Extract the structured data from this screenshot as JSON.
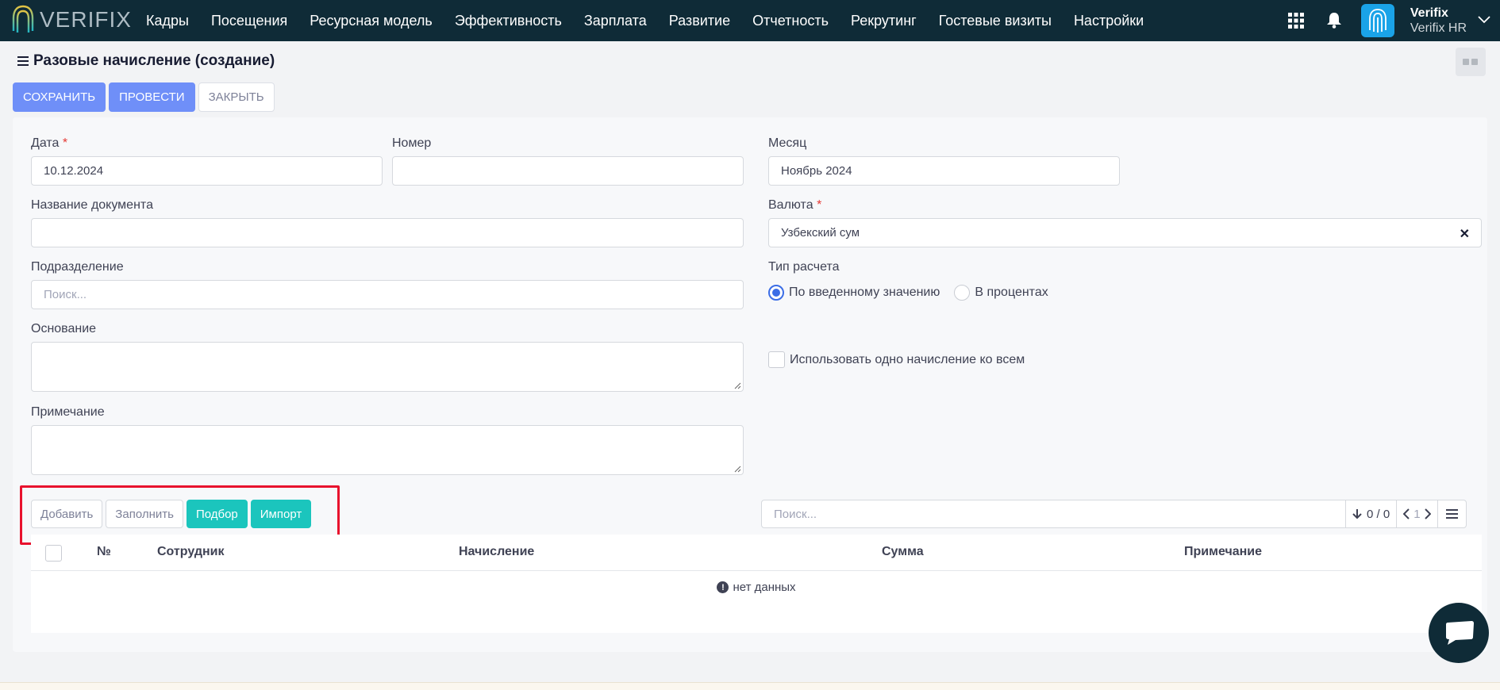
{
  "app": {
    "logo_text": "VERIFIX",
    "nav": [
      "Кадры",
      "Посещения",
      "Ресурсная модель",
      "Эффективность",
      "Зарплата",
      "Развитие",
      "Отчетность",
      "Рекрутинг",
      "Гостевые визиты",
      "Настройки"
    ],
    "user": {
      "name": "Verifix",
      "org": "Verifix HR"
    }
  },
  "page": {
    "title": "Разовые начисление (создание)",
    "actions": {
      "save": "Сохранить",
      "post": "Провести",
      "close": "Закрыть"
    }
  },
  "form": {
    "date": {
      "label": "Дата",
      "required": "*",
      "value": "10.12.2024"
    },
    "number": {
      "label": "Номер",
      "value": ""
    },
    "month": {
      "label": "Месяц",
      "value": "Ноябрь 2024"
    },
    "doc_name": {
      "label": "Название документа",
      "value": ""
    },
    "currency": {
      "label": "Валюта",
      "required": "*",
      "value": "Узбекский сум",
      "clear": "✕"
    },
    "division": {
      "label": "Подразделение",
      "placeholder": "Поиск..."
    },
    "calc_type": {
      "label": "Тип расчета",
      "options": [
        "По введенному значению",
        "В процентах"
      ],
      "selected": "По введенному значению"
    },
    "basis": {
      "label": "Основание"
    },
    "one_accrual": {
      "label": "Использовать одно начисление ко всем",
      "checked": false
    },
    "note": {
      "label": "Примечание"
    }
  },
  "grid": {
    "buttons": {
      "add": "Добавить",
      "fill": "Заполнить",
      "pick": "Подбор",
      "import": "Импорт"
    },
    "search_placeholder": "Поиск...",
    "pager": {
      "count": "0 / 0",
      "page": "1"
    },
    "columns": [
      "№",
      "Сотрудник",
      "Начисление",
      "Сумма",
      "Примечание"
    ],
    "empty_text": "нет данных"
  },
  "colors": {
    "navbar": "#0f2b37",
    "primary": "#6f8ff8",
    "teal": "#1bc5bd",
    "highlight": "#e8112d"
  }
}
